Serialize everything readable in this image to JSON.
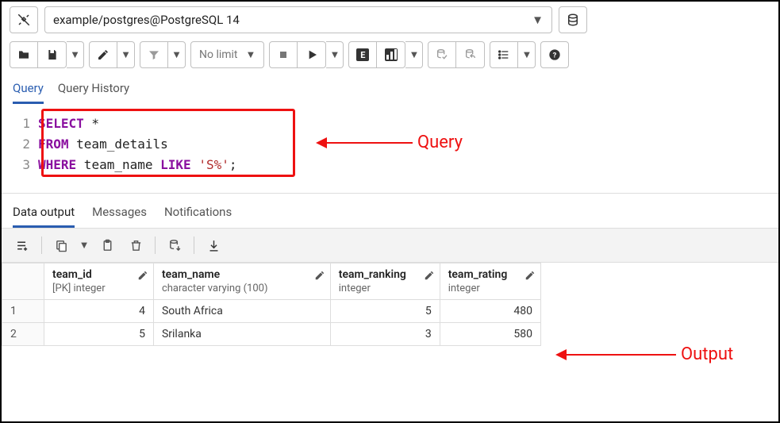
{
  "connection": {
    "label": "example/postgres@PostgreSQL 14"
  },
  "toolbar": {
    "limit_label": "No limit",
    "e_label": "E"
  },
  "query_tabs": {
    "query": "Query",
    "history": "Query History"
  },
  "editor": {
    "lines": [
      {
        "n": "1",
        "tokens": [
          {
            "t": "SELECT",
            "c": "kw"
          },
          {
            "t": " *"
          }
        ]
      },
      {
        "n": "2",
        "tokens": [
          {
            "t": "FROM",
            "c": "kw"
          },
          {
            "t": " team_details"
          }
        ]
      },
      {
        "n": "3",
        "tokens": [
          {
            "t": "WHERE",
            "c": "kw"
          },
          {
            "t": " team_name "
          },
          {
            "t": "LIKE",
            "c": "kw"
          },
          {
            "t": " "
          },
          {
            "t": "'S%'",
            "c": "str"
          },
          {
            "t": ";"
          }
        ]
      }
    ]
  },
  "annot": {
    "query": "Query",
    "output": "Output"
  },
  "out_tabs": {
    "data": "Data output",
    "messages": "Messages",
    "notifications": "Notifications"
  },
  "table": {
    "columns": [
      {
        "name": "team_id",
        "sub": "[PK] integer"
      },
      {
        "name": "team_name",
        "sub": "character varying (100)"
      },
      {
        "name": "team_ranking",
        "sub": "integer"
      },
      {
        "name": "team_rating",
        "sub": "integer"
      }
    ],
    "rows": [
      {
        "n": "1",
        "team_id": "4",
        "team_name": "South Africa",
        "team_ranking": "5",
        "team_rating": "480"
      },
      {
        "n": "2",
        "team_id": "5",
        "team_name": "Srilanka",
        "team_ranking": "3",
        "team_rating": "580"
      }
    ]
  }
}
